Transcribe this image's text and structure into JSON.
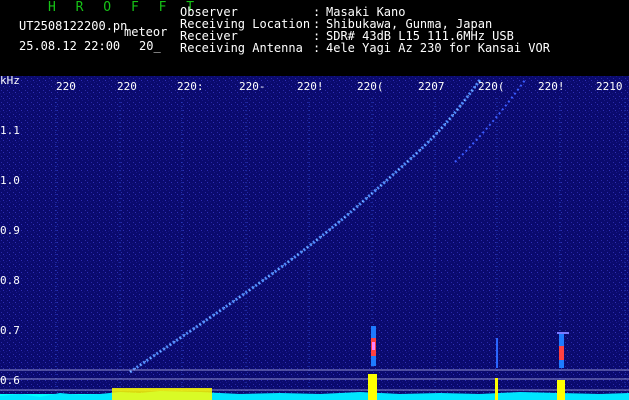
{
  "header": {
    "title": "H R O F F T",
    "file_name": "UT2508122200.pn",
    "file_suffix": "meteor",
    "date_time": "25.08.12 22:00",
    "date_sub": "20_",
    "rows": [
      {
        "key": "Observer",
        "value": "Masaki Kano"
      },
      {
        "key": "Receiving Location",
        "value": "Shibukawa, Gunma, Japan"
      },
      {
        "key": "Receiver",
        "value": "SDR# 43dB L15 111.6MHz USB"
      },
      {
        "key": "Receiving Antenna",
        "value": "4ele Yagi Az 230 for Kansai VOR"
      }
    ]
  },
  "axes": {
    "unit": "kHz",
    "y_ticks": [
      "1.1",
      "1.0",
      "0.9",
      "0.8",
      "0.7",
      "0.6"
    ],
    "x_ticks": [
      "220",
      "220",
      "220:",
      "220-",
      "220!",
      "220(",
      "2207",
      "220(",
      "220!",
      "2210"
    ]
  },
  "colors": {
    "background": "#0a0a6e",
    "trail": "#4f8cff",
    "signal": "#ffff00",
    "baseline": "#00ffff",
    "title": "#16c216"
  }
}
